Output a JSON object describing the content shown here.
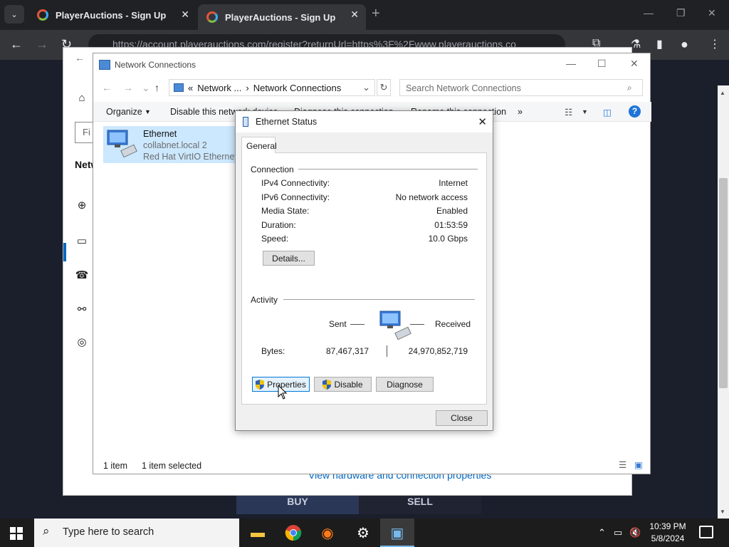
{
  "browser": {
    "tabs": [
      {
        "title": "PlayerAuctions - Sign Up"
      },
      {
        "title": "PlayerAuctions - Sign Up"
      }
    ],
    "url": "https://account.playerauctions.com/register?returnUrl=https%3F%2Fwww.playerauctions.co",
    "page": {
      "buy_label": "BUY",
      "sell_label": "SELL"
    }
  },
  "settings": {
    "find_placeholder": "Fi",
    "heading": "Netw",
    "link": "View hardware and connection properties"
  },
  "network_window": {
    "title": "Network Connections",
    "breadcrumb_prefix": "«",
    "breadcrumb_parent": "Network ...",
    "breadcrumb_current": "Network Connections",
    "search_placeholder": "Search Network Connections",
    "commands": {
      "organize": "Organize",
      "disable": "Disable this network device",
      "diagnose": "Diagnose this connection",
      "rename": "Rename this connection",
      "more": "»"
    },
    "item": {
      "name": "Ethernet",
      "network": "collabnet.local 2",
      "adapter": "Red Hat VirtIO Ethernet A"
    },
    "status": {
      "count": "1 item",
      "selected": "1 item selected"
    }
  },
  "dialog": {
    "title": "Ethernet Status",
    "tab": "General",
    "connection": {
      "label": "Connection",
      "rows": [
        {
          "key": "IPv4 Connectivity:",
          "value": "Internet"
        },
        {
          "key": "IPv6 Connectivity:",
          "value": "No network access"
        },
        {
          "key": "Media State:",
          "value": "Enabled"
        },
        {
          "key": "Duration:",
          "value": "01:53:59"
        },
        {
          "key": "Speed:",
          "value": "10.0 Gbps"
        }
      ],
      "details_button": "Details..."
    },
    "activity": {
      "label": "Activity",
      "sent_label": "Sent",
      "received_label": "Received",
      "bytes_label": "Bytes:",
      "bytes_sent": "87,467,317",
      "bytes_received": "24,970,852,719"
    },
    "buttons": {
      "properties": "Properties",
      "disable": "Disable",
      "diagnose": "Diagnose",
      "close": "Close"
    }
  },
  "taskbar": {
    "search_placeholder": "Type here to search",
    "time": "10:39 PM",
    "date": "5/8/2024"
  },
  "colors": {
    "accent": "#0078d7",
    "selection": "#cce8ff",
    "page_bg": "#1b1e2b"
  }
}
